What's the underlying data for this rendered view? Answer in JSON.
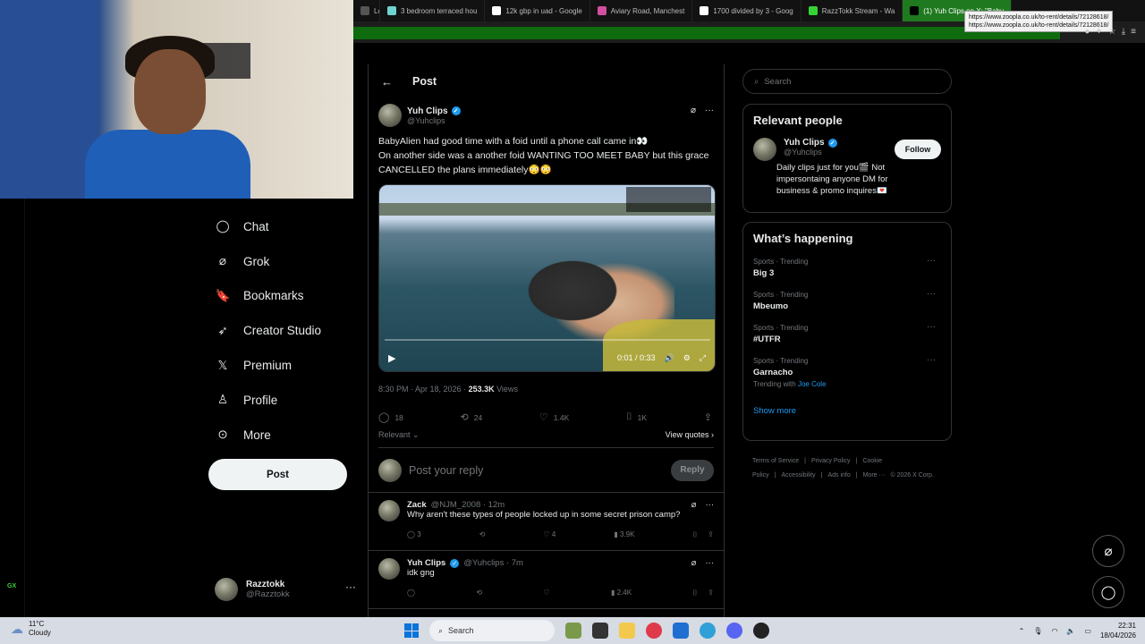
{
  "browser": {
    "tabs": [
      {
        "label": "Lo",
        "color": "#555555"
      },
      {
        "label": "3 bedroom terraced hou",
        "color": "#6fd3d3"
      },
      {
        "label": "12k gbp in uad - Google",
        "color": "#ffffff"
      },
      {
        "label": "Aviary Road, Manchest",
        "color": "#d04fa0"
      },
      {
        "label": "1700 divided by 3 - Goog",
        "color": "#ffffff"
      },
      {
        "label": "RazzTokk Stream - Wa",
        "color": "#35d435"
      },
      {
        "label": "(1) Yuh Clips on X: \"Baby",
        "color": "#000000"
      }
    ],
    "tooltip_line1": "https://www.zoopla.co.uk/to-rent/details/72128618/",
    "tooltip_line2": "https://www.zoopla.co.uk/to-rent/details/72128618/"
  },
  "nav": {
    "items": [
      {
        "label": "Chat",
        "icon": "chat-icon",
        "glyph": "◯"
      },
      {
        "label": "Grok",
        "icon": "grok-icon",
        "glyph": "⌀"
      },
      {
        "label": "Bookmarks",
        "icon": "bookmark-icon",
        "glyph": "🔖"
      },
      {
        "label": "Creator Studio",
        "icon": "rocket-icon",
        "glyph": "➶"
      },
      {
        "label": "Premium",
        "icon": "x-logo-icon",
        "glyph": "𝕏"
      },
      {
        "label": "Profile",
        "icon": "person-icon",
        "glyph": "♙"
      },
      {
        "label": "More",
        "icon": "more-circle-icon",
        "glyph": "⊙"
      }
    ],
    "post_label": "Post",
    "account_name": "Razztokk",
    "account_handle": "@Razztokk",
    "account_more": "···",
    "gx": "GX"
  },
  "main": {
    "back": "←",
    "title": "Post",
    "tweet": {
      "name": "Yuh Clips",
      "handle": "@Yuhclips",
      "text_line1": "BabyAlien had good time with a foid until a phone call came in👀",
      "text_line2": "On another side was a another foid WANTING TOO MEET BABY but this grace CANCELLED the plans immediately😳😳",
      "video_time": "0:01 / 0:33",
      "timestamp": "8:30 PM · Apr 18, 2026 · ",
      "views_count": "253.3K",
      "views_label": " Views",
      "replies": "18",
      "reposts": "24",
      "likes": "1.4K",
      "bookmarks": "1K",
      "sort_label": "Relevant ⌄",
      "view_quotes": "View quotes ›"
    },
    "reply_placeholder": "Post your reply",
    "reply_button": "Reply",
    "replies": [
      {
        "name": "Zack",
        "handle": "@NJM_2008 · 12m",
        "text": "Why aren't these types of people locked up in some secret prison camp?",
        "replies": "3",
        "reposts": "",
        "likes": "4",
        "views": "3.9K"
      },
      {
        "name": "Yuh Clips",
        "handle": "@Yuhclips · 7m",
        "text": "idk gng",
        "replies": "",
        "reposts": "",
        "likes": "",
        "views": "2.4K"
      }
    ]
  },
  "sidebar": {
    "search_placeholder": "Search",
    "relevant_title": "Relevant people",
    "person": {
      "name": "Yuh Clips",
      "handle": "@Yuhclips",
      "bio": "Daily clips just for you🎬 Not impersontaing anyone DM for business & promo inquires💌",
      "follow": "Follow"
    },
    "whats_happening_title": "What’s happening",
    "trends": [
      {
        "category": "Sports · Trending",
        "name": "Big 3",
        "sub": ""
      },
      {
        "category": "Sports · Trending",
        "name": "Mbeumo",
        "sub": ""
      },
      {
        "category": "Sports · Trending",
        "name": "#UTFR",
        "sub": ""
      },
      {
        "category": "Sports · Trending",
        "name": "Garnacho",
        "sub": "Trending with ",
        "sub_link": "Joe Cole"
      }
    ],
    "show_more": "Show more",
    "footer": [
      "Terms of Service",
      "|",
      "Privacy Policy",
      "|",
      "Cookie Policy",
      "|",
      "Accessibility",
      "|",
      "Ads info",
      "|",
      "More ···",
      "© 2026 X Corp."
    ]
  },
  "taskbar": {
    "temp": "11°C",
    "condition": "Cloudy",
    "search": "Search",
    "time": "22:31",
    "date": "18/04/2026"
  }
}
